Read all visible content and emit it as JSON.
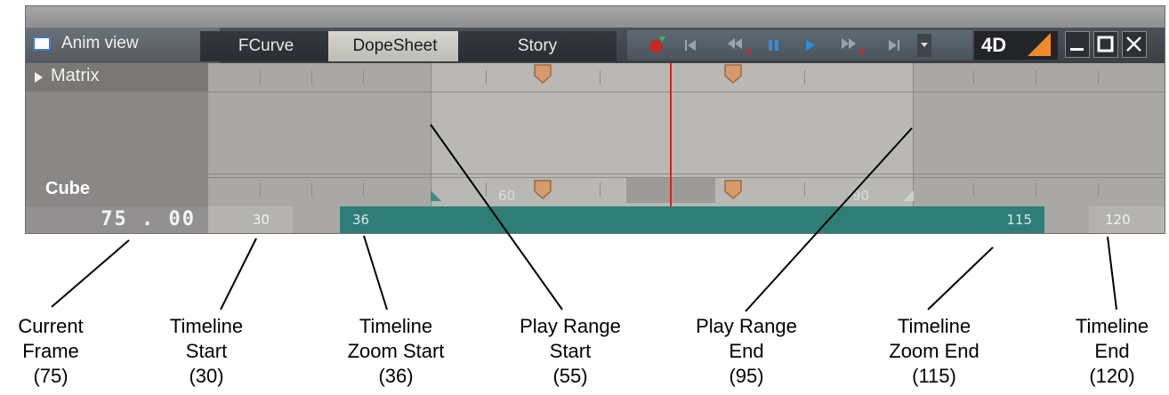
{
  "window": {
    "title": "Anim view",
    "tabs": [
      "FCurve",
      "DopeSheet",
      "Story"
    ],
    "active_tab": "DopeSheet",
    "mode_button": "4D",
    "accent": "#2f7d77",
    "playhead_color": "#e02020"
  },
  "tracks": {
    "matrix_label": "Matrix",
    "cube_label": "Cube"
  },
  "timeline": {
    "current_frame": "75 . 00",
    "labels": {
      "start": "30",
      "zoom_start": "36",
      "zoom_end": "115",
      "end": "120",
      "ruler_60": "60",
      "ruler_90": "90"
    }
  },
  "callouts": [
    {
      "id": "current-frame",
      "lines": [
        "Current",
        "Frame",
        "(75)"
      ]
    },
    {
      "id": "timeline-start",
      "lines": [
        "Timeline",
        "Start",
        "(30)"
      ]
    },
    {
      "id": "timeline-zoom-start",
      "lines": [
        "Timeline",
        "Zoom Start",
        "(36)"
      ]
    },
    {
      "id": "play-range-start",
      "lines": [
        "Play Range",
        "Start",
        "(55)"
      ]
    },
    {
      "id": "play-range-end",
      "lines": [
        "Play Range",
        "End",
        "(95)"
      ]
    },
    {
      "id": "timeline-zoom-end",
      "lines": [
        "Timeline",
        "Zoom End",
        "(115)"
      ]
    },
    {
      "id": "timeline-end",
      "lines": [
        "Timeline",
        "End",
        "(120)"
      ]
    }
  ]
}
